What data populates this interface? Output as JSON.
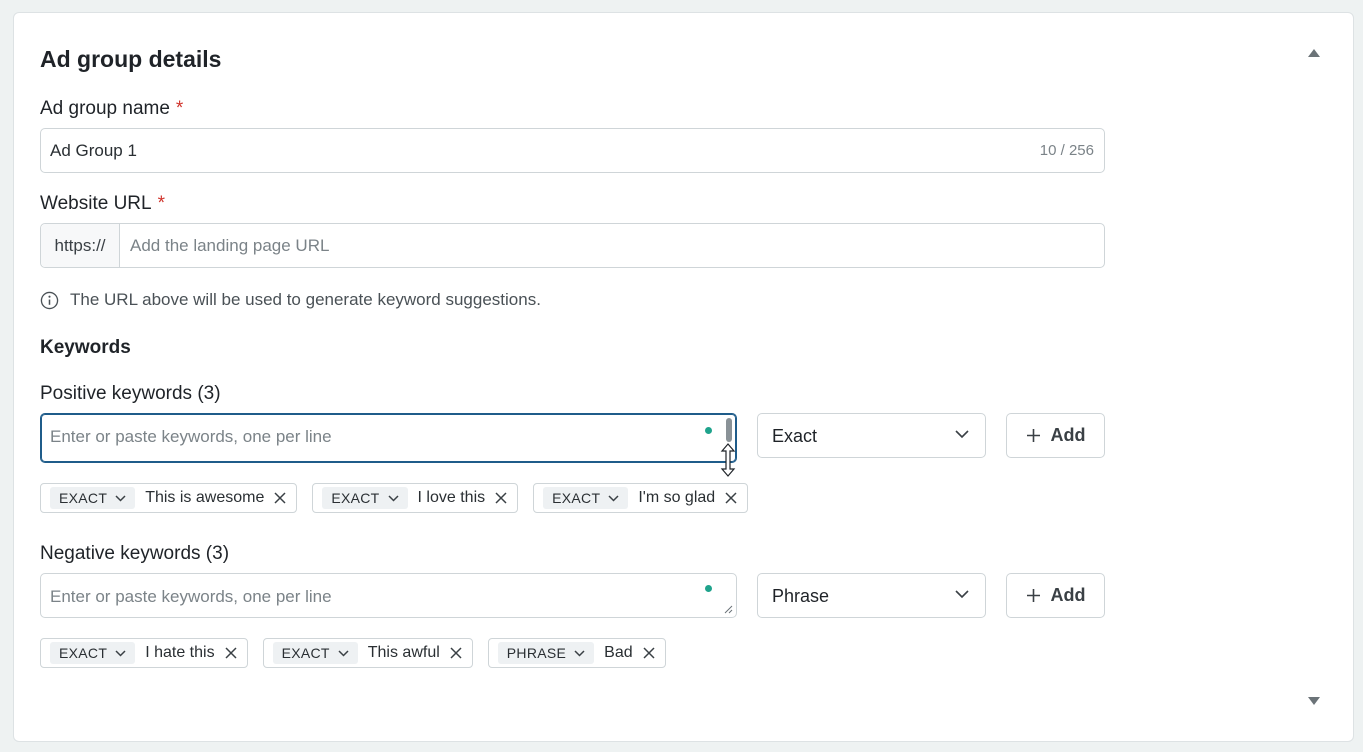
{
  "section": {
    "title": "Ad group details"
  },
  "ad_group_name": {
    "label": "Ad group name",
    "required_mark": "*",
    "value": "Ad Group 1",
    "counter": "10 / 256"
  },
  "website_url": {
    "label": "Website URL",
    "required_mark": "*",
    "prefix": "https://",
    "placeholder": "Add the landing page URL",
    "hint": "The URL above will be used to generate keyword suggestions."
  },
  "keywords": {
    "heading": "Keywords",
    "positive": {
      "label": "Positive keywords (3)",
      "placeholder": "Enter or paste keywords, one per line",
      "match_type": "Exact",
      "add_label": "Add",
      "chips": [
        {
          "type": "EXACT",
          "text": "This is awesome"
        },
        {
          "type": "EXACT",
          "text": "I love this"
        },
        {
          "type": "EXACT",
          "text": "I'm so glad"
        }
      ]
    },
    "negative": {
      "label": "Negative keywords (3)",
      "placeholder": "Enter or paste keywords, one per line",
      "match_type": "Phrase",
      "add_label": "Add",
      "chips": [
        {
          "type": "EXACT",
          "text": "I hate this"
        },
        {
          "type": "EXACT",
          "text": "This awful"
        },
        {
          "type": "PHRASE",
          "text": "Bad"
        }
      ]
    }
  },
  "colors": {
    "required": "#d0342c",
    "focus_border": "#1f5c8a",
    "status_dot": "#1fa38c"
  }
}
